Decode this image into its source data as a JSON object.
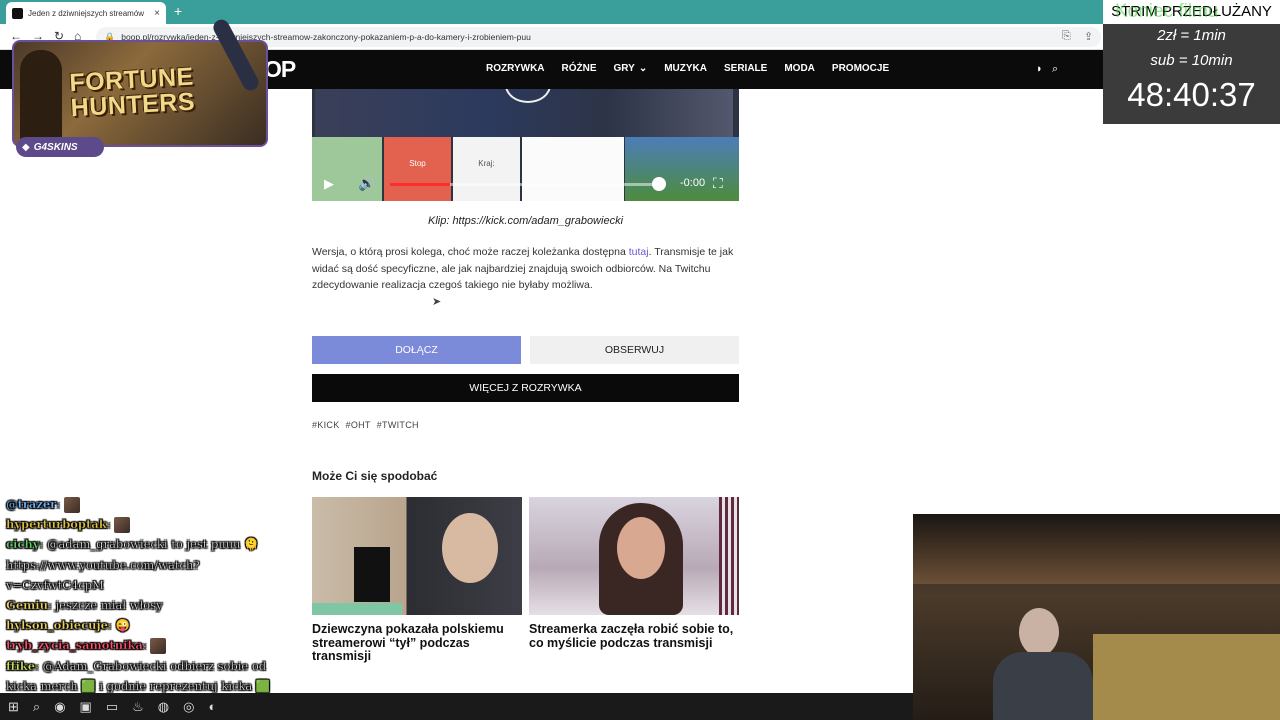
{
  "browser": {
    "tab_title": "Jeden z dziwniejszych streamów",
    "tab_close": "×",
    "new_tab": "+",
    "url": "boop.pl/rozrywka/jeden-z-dziwniejszych-streamow-zakonczony-pokazaniem-p-a-do-kamery-i-zrobieniem-puu",
    "icons": [
      "back-icon",
      "forward-icon",
      "reload-icon",
      "home-icon",
      "lock-icon",
      "share-icon"
    ]
  },
  "site": {
    "logo": "OP",
    "nav": [
      "ROZRYWKA",
      "RÓŻNE",
      "GRY",
      "MUZYKA",
      "SERIALE",
      "MODA",
      "PROMOCJE"
    ],
    "nav_dropdown_mark": "⌄"
  },
  "article": {
    "video": {
      "stop_label": "Stop",
      "kraj_label": "Kraj:",
      "time": "-0:00"
    },
    "caption": "Klip: https://kick.com/adam_grabowiecki",
    "paragraph_before_link": "Wersja, o którą prosi kolega, choć może raczej koleżanka dostępna ",
    "paragraph_link": "tutaj",
    "paragraph_after_link": ". Transmisje te jak widać są dość specyficzne, ale jak najbardziej znajdują swoich odbiorców. Na Twitchu zdecydowanie realizacja czegoś takiego nie byłaby możliwa.",
    "join_button": "DOŁĄCZ",
    "follow_button": "OBSERWUJ",
    "more_button": "WIĘCEJ Z ROZRYWKA",
    "tags": [
      "#KICK",
      "#OHT",
      "#TWITCH"
    ],
    "related_title": "Może Ci się spodobać",
    "related": [
      {
        "title": "Dziewczyna pokazała polskiemu streamerowi “tył” podczas transmisji"
      },
      {
        "title": "Streamerka zaczęła robić sobie to, co myślicie podczas transmisji"
      }
    ]
  },
  "overlay": {
    "ad": {
      "title": "FORTUNE HUNTERS",
      "badge": "G4SKINS"
    },
    "subathon": {
      "banner": "STRIM PRZEDŁUŻANY",
      "ghost_text": "Koniec filmu",
      "rate1": "2zł = 1min",
      "rate2": "sub = 10min",
      "timer": "48:40:37"
    },
    "chat": [
      {
        "user": "@trazer",
        "user_color": "#6fb6ff",
        "text": "",
        "emote": true
      },
      {
        "user": "hyperturboptak",
        "user_color": "#e0c040",
        "text": "",
        "emote": true
      },
      {
        "user": "cichy",
        "user_color": "#60d060",
        "text": "@adam_grabowiecki to jest puuu 🫠"
      },
      {
        "user": "",
        "user_color": "#ffffff",
        "text": "https://www.youtube.com/watch?"
      },
      {
        "user": "",
        "user_color": "#ffffff",
        "text": "v=CzvfwtC4cpM"
      },
      {
        "user": "Gemiu",
        "user_color": "#e8d05a",
        "text": "jeszcze miał włosy"
      },
      {
        "user": "hylson_obiecuje",
        "user_color": "#e8d05a",
        "text": "😜"
      },
      {
        "user": "tryb_zycia_samotnika",
        "user_color": "#ff4f6a",
        "text": "",
        "emote": true
      },
      {
        "user": "ffike",
        "user_color": "#c8e060",
        "text": "@Adam_Grabowiecki odbierz sobie od"
      },
      {
        "user": "",
        "user_color": "#ffffff",
        "text": "kicka merch 🟩 i godnie reprezentuj kicka 🟩"
      }
    ]
  },
  "taskbar": {
    "items": [
      "windows-icon",
      "search-icon",
      "chrome-icon",
      "store-icon",
      "folder-icon",
      "steam-icon",
      "firefox-icon",
      "record-icon",
      "obs-icon"
    ],
    "glyphs": [
      "⊞",
      "⌕",
      "◉",
      "▣",
      "▭",
      "♨",
      "◍",
      "◎",
      "◐"
    ]
  },
  "colors": {
    "tabbar": "#3a9f9a",
    "join_button": "#7b8ad9",
    "header": "#0b0b0b",
    "link": "#6a5acd"
  }
}
